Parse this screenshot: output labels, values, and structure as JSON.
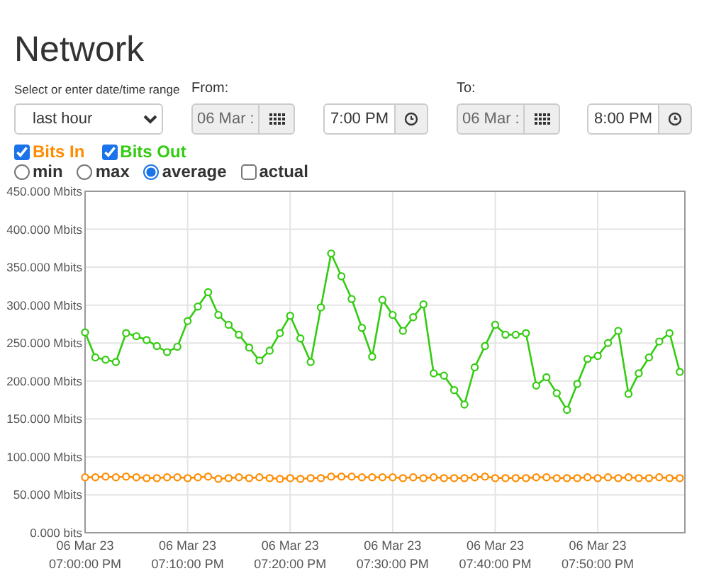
{
  "title": "Network",
  "range": {
    "label": "Select or enter date/time range",
    "value": "last hour"
  },
  "from": {
    "label": "From:",
    "date": "06 Mar :",
    "time": "7:00 PM"
  },
  "to": {
    "label": "To:",
    "date": "06 Mar :",
    "time": "8:00 PM"
  },
  "series_toggles": [
    {
      "checked": true
    },
    {
      "checked": true
    }
  ],
  "modes": [
    {
      "label": "min",
      "kind": "radio",
      "selected": false
    },
    {
      "label": "max",
      "kind": "radio",
      "selected": false
    },
    {
      "label": "average",
      "kind": "radio",
      "selected": true
    },
    {
      "label": "actual",
      "kind": "checkbox",
      "checked": false
    }
  ],
  "chart_data": {
    "type": "line",
    "categories": [
      "06 Mar 23\n07:00:00 PM",
      null,
      null,
      null,
      null,
      null,
      null,
      null,
      null,
      null,
      "06 Mar 23\n07:10:00 PM",
      null,
      null,
      null,
      null,
      null,
      null,
      null,
      null,
      null,
      "06 Mar 23\n07:20:00 PM",
      null,
      null,
      null,
      null,
      null,
      null,
      null,
      null,
      null,
      "06 Mar 23\n07:30:00 PM",
      null,
      null,
      null,
      null,
      null,
      null,
      null,
      null,
      null,
      "06 Mar 23\n07:40:00 PM",
      null,
      null,
      null,
      null,
      null,
      null,
      null,
      null,
      null,
      "06 Mar 23\n07:50:00 PM",
      null,
      null,
      null,
      null,
      null,
      null,
      null,
      null
    ],
    "ylim": [
      0,
      450
    ],
    "grid": true,
    "yticks": [
      {
        "value": 0,
        "label": "0.000 bits"
      },
      {
        "value": 50,
        "label": "50.000 Mbits"
      },
      {
        "value": 100,
        "label": "100.000 Mbits"
      },
      {
        "value": 150,
        "label": "150.000 Mbits"
      },
      {
        "value": 200,
        "label": "200.000 Mbits"
      },
      {
        "value": 250,
        "label": "250.000 Mbits"
      },
      {
        "value": 300,
        "label": "300.000 Mbits"
      },
      {
        "value": 350,
        "label": "350.000 Mbits"
      },
      {
        "value": 400,
        "label": "400.000 Mbits"
      },
      {
        "value": 450,
        "label": "450.000 Mbits"
      }
    ],
    "series": [
      {
        "name": "Bits In",
        "color": "#ff8c00",
        "marker": "circle",
        "values": [
          73,
          73,
          74,
          73,
          74,
          73,
          72,
          72,
          73,
          73,
          72,
          73,
          74,
          71,
          72,
          73,
          72,
          73,
          72,
          71,
          72,
          71,
          72,
          72,
          74,
          74,
          74,
          73,
          73,
          73,
          73,
          72,
          73,
          72,
          73,
          72,
          72,
          72,
          73,
          74,
          72,
          72,
          72,
          72,
          73,
          73,
          72,
          72,
          72,
          73,
          72,
          73,
          72,
          73,
          72,
          72,
          73,
          72,
          72
        ]
      },
      {
        "name": "Bits Out",
        "color": "#33cc11",
        "marker": "circle",
        "values": [
          264,
          231,
          228,
          225,
          263,
          259,
          254,
          246,
          238,
          245,
          279,
          298,
          317,
          287,
          274,
          261,
          244,
          227,
          240,
          263,
          286,
          256,
          225,
          297,
          368,
          338,
          308,
          270,
          232,
          307,
          287,
          266,
          284,
          301,
          210,
          207,
          188,
          169,
          218,
          246,
          274,
          261,
          261,
          263,
          194,
          205,
          184,
          162,
          196,
          229,
          233,
          250,
          266,
          183,
          210,
          231,
          252,
          263,
          212
        ]
      }
    ]
  }
}
